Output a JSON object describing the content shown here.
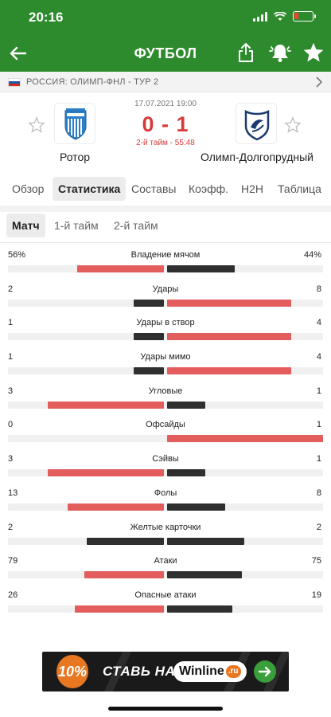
{
  "status_bar": {
    "time": "20:16"
  },
  "header": {
    "title": "ФУТБОЛ"
  },
  "league": {
    "text": "РОССИЯ: ОЛИМП-ФНЛ - ТУР 2"
  },
  "match": {
    "datetime": "17.07.2021 19:00",
    "score": "0 - 1",
    "status": "2-й тайм - 55:48",
    "home": {
      "name": "Ротор"
    },
    "away": {
      "name": "Олимп-Долгопрудный"
    }
  },
  "tabs": [
    {
      "label": "Обзор"
    },
    {
      "label": "Статистика"
    },
    {
      "label": "Составы"
    },
    {
      "label": "Коэфф."
    },
    {
      "label": "H2H"
    },
    {
      "label": "Таблица"
    }
  ],
  "active_tab": "Статистика",
  "subtabs": [
    {
      "label": "Матч"
    },
    {
      "label": "1-й тайм"
    },
    {
      "label": "2-й тайм"
    }
  ],
  "active_subtab": "Матч",
  "stats": [
    {
      "name": "Владение мячом",
      "home": "56%",
      "away": "44%",
      "h": 56,
      "a": 44
    },
    {
      "name": "Удары",
      "home": "2",
      "away": "8",
      "h": 2,
      "a": 8
    },
    {
      "name": "Удары в створ",
      "home": "1",
      "away": "4",
      "h": 1,
      "a": 4
    },
    {
      "name": "Удары мимо",
      "home": "1",
      "away": "4",
      "h": 1,
      "a": 4
    },
    {
      "name": "Угловые",
      "home": "3",
      "away": "1",
      "h": 3,
      "a": 1
    },
    {
      "name": "Офсайды",
      "home": "0",
      "away": "1",
      "h": 0,
      "a": 1
    },
    {
      "name": "Сэйвы",
      "home": "3",
      "away": "1",
      "h": 3,
      "a": 1
    },
    {
      "name": "Фолы",
      "home": "13",
      "away": "8",
      "h": 13,
      "a": 8
    },
    {
      "name": "Желтые карточки",
      "home": "2",
      "away": "2",
      "h": 2,
      "a": 2
    },
    {
      "name": "Атаки",
      "home": "79",
      "away": "75",
      "h": 79,
      "a": 75
    },
    {
      "name": "Опасные атаки",
      "home": "26",
      "away": "19",
      "h": 26,
      "a": 19
    }
  ],
  "banner": {
    "badge": "10%",
    "cta": "СТАВЬ НА",
    "brand": "Winline",
    "brand_suffix": ".ru"
  },
  "colors": {
    "primary_green": "#2d8a2d",
    "winner_bar": "#e35d5d",
    "other_bar": "#2f2f2f",
    "score_red": "#d63b3b"
  },
  "icons": {
    "back": "arrow-left-icon",
    "share": "share-icon",
    "bell": "bell-icon",
    "favorite": "star-icon",
    "chevron": "chevron-right-icon"
  }
}
